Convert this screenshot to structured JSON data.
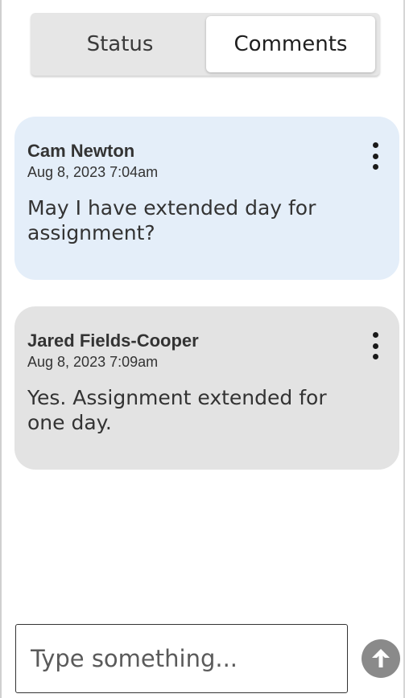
{
  "tabs": {
    "status_label": "Status",
    "comments_label": "Comments",
    "active": "Comments"
  },
  "comments": [
    {
      "author": "Cam Newton",
      "timestamp": "Aug 8, 2023 7:04am",
      "text": "May I have extended day for assignment?",
      "background": "#e4eef9",
      "menu_icon": "more-vertical-icon"
    },
    {
      "author": "Jared Fields-Cooper",
      "timestamp": "Aug 8, 2023 7:09am",
      "text": "Yes. Assignment extended for one day.",
      "background": "#e3e3e3",
      "menu_icon": "more-vertical-icon"
    }
  ],
  "composer": {
    "placeholder": "Type something...",
    "value": "",
    "send_icon": "arrow-up-circle-icon"
  },
  "colors": {
    "accent_bubble": "#e4eef9",
    "neutral_bubble": "#e3e3e3",
    "send_button": "#8a8a8a"
  }
}
